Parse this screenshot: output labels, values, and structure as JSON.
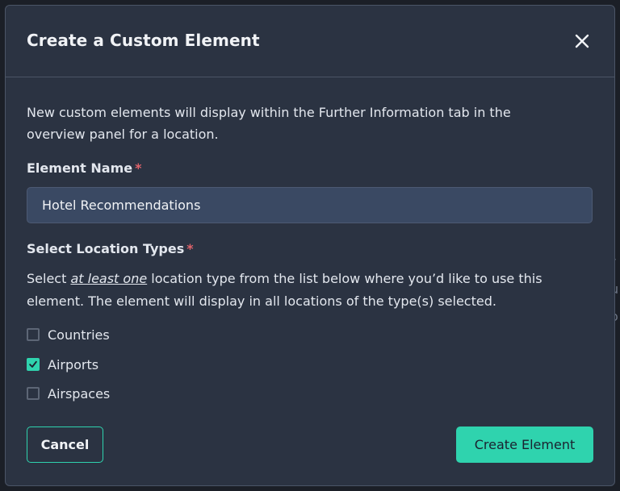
{
  "background": {
    "peek_text": [
      "r",
      "u",
      "o"
    ]
  },
  "modal": {
    "title": "Create a Custom Element",
    "close_icon": "close-icon",
    "description": "New custom elements will display within the Further Information tab in the overview panel for a location.",
    "element_name": {
      "label": "Element Name",
      "required_marker": "*",
      "value": "Hotel Recommendations"
    },
    "location_types": {
      "label": "Select Location Types",
      "required_marker": "*",
      "instructions_prefix": "Select ",
      "instructions_emphasis": "at least one",
      "instructions_suffix": " location type from the list below where you’d like to use this element. The element will display in all locations of the type(s) selected.",
      "options": [
        {
          "label": "Countries",
          "checked": false
        },
        {
          "label": "Airports",
          "checked": true
        },
        {
          "label": "Airspaces",
          "checked": false
        }
      ]
    },
    "buttons": {
      "cancel": "Cancel",
      "create": "Create Element"
    }
  },
  "colors": {
    "accent": "#2fd3ae",
    "modal_bg": "#2b3342",
    "input_bg": "#3a4963",
    "required": "#e0636b"
  }
}
